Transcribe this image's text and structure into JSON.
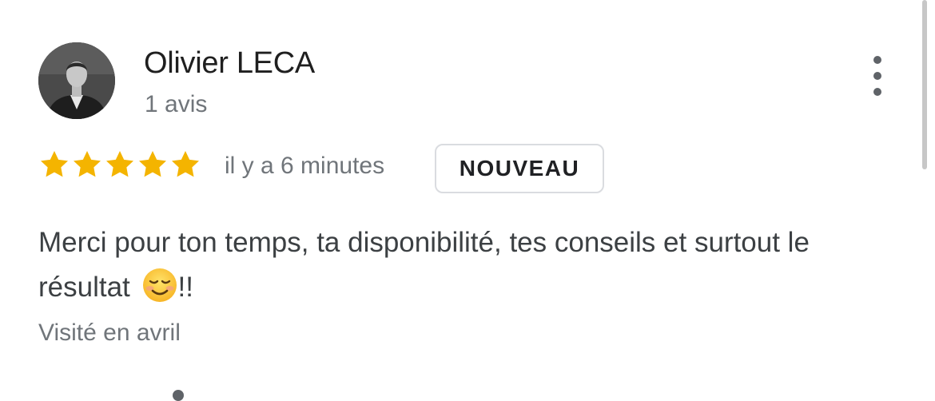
{
  "reviewer": {
    "name": "Olivier LECA",
    "review_count": "1 avis"
  },
  "review": {
    "rating": 5,
    "rating_max": 5,
    "time_ago": "il y a 6 minutes",
    "badge": "NOUVEAU",
    "text": "Merci pour ton temps, ta disponibilité, tes conseils et surtout le résultat",
    "text_suffix": "!!",
    "emoji": "smiling-face-emoji",
    "visited": "Visité en avril"
  },
  "icons": {
    "more": "more-vert-icon",
    "star": "star-icon"
  },
  "colors": {
    "star": "#F4B400",
    "secondary_text": "#70757A",
    "primary_text": "#1F1F1F",
    "badge_border": "#DADCE0"
  }
}
